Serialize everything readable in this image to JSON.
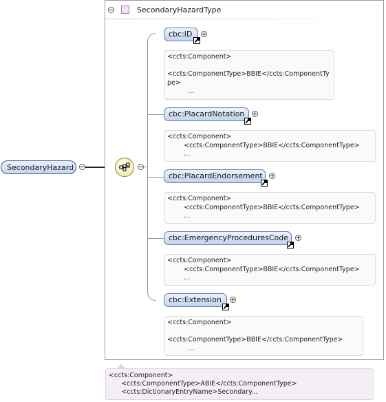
{
  "root": {
    "label": "SecondaryHazard"
  },
  "type": {
    "name": "SecondaryHazardType"
  },
  "elements": [
    {
      "label": "cbc:ID",
      "annotation": "<ccts:Component>\n\n<ccts:ComponentType>BBIE</ccts:ComponentTy\npe>\n          ..."
    },
    {
      "label": "cbc:PlacardNotation",
      "annotation": "<ccts:Component>\n        <ccts:ComponentType>BBIE</ccts:ComponentType>\n        ..."
    },
    {
      "label": "cbc:PlacardEndorsement",
      "annotation": "<ccts:Component>\n        <ccts:ComponentType>BBIE</ccts:ComponentType>\n        ..."
    },
    {
      "label": "cbc:EmergencyProceduresCode",
      "annotation": "<ccts:Component>\n        <ccts:ComponentType>BBIE</ccts:ComponentType>\n        ..."
    },
    {
      "label": "cbc:Extension",
      "annotation": "<ccts:Component>\n\n<ccts:ComponentType>BBIE</ccts:ComponentType>\n          ..."
    }
  ],
  "type_annotation": "<ccts:Component>\n      <ccts:ComponentType>ABIE</ccts:ComponentType>\n      <ccts:DictionaryEntryName>Secondary..."
}
